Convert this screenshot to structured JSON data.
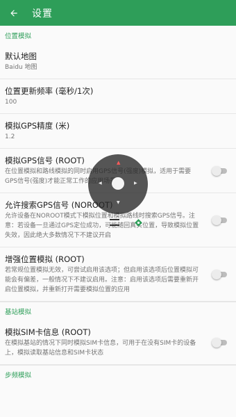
{
  "appbar": {
    "title": "设置",
    "back_icon": "arrow-back-icon"
  },
  "sections": {
    "location": "位置模拟",
    "base_station": "基站模拟",
    "step": "步频模拟"
  },
  "prefs": {
    "default_map": {
      "title": "默认地图",
      "summary": "Baidu 地图"
    },
    "update_freq": {
      "title": "位置更新频率 (毫秒/1次)",
      "summary": "100"
    },
    "gps_accuracy": {
      "title": "模拟GPS精度 (米)",
      "summary": "1.2"
    },
    "gps_signal": {
      "title": "模拟GPS信号 (ROOT)",
      "summary": "在位置模拟和路线模拟的同时启用GPS信号(强度)模拟，适用于需要GPS信号(强度)才能正常工作的应用场景",
      "enabled": false
    },
    "allow_search": {
      "title": "允许搜索GPS信号 (NOROOT)",
      "summary": "允许设备在NOROOT模式下模拟位置和模拟路线时搜索GPS信号。注意：若设备一旦通过GPS定位成功，可能随回真实位置，导致模拟位置失效，因此绝大多数情况下不建议开启",
      "enabled": false
    },
    "enhanced": {
      "title": "增强位置模拟 (ROOT)",
      "summary": "若常规位置模拟无效，可尝试启用该选项；但启用该选项后位置模拟可能会有偏差，一般情况下不建议启用。注意：启用该选项后需要重新开启位置模拟，并重新打开需要模拟位置的应用",
      "enabled": false
    },
    "sim_info": {
      "title": "模拟SIM卡信息 (ROOT)",
      "summary": "在模拟基站的情况下同时模拟SIM卡信息，可用于在没有SIM卡的设备上，模拟读取基站信息和SIM卡状态",
      "enabled": false
    }
  },
  "floating": {
    "joystick_up_label": "▲",
    "joystick_down_label": "▼",
    "joystick_left_label": "◀",
    "joystick_right_label": "▶",
    "icons": [
      "joystick-icon",
      "menu-icon",
      "navigation-icon"
    ]
  },
  "colors": {
    "accent": "#2e9e59",
    "switch_off": "#bdbdbd",
    "joystick_up": "#ff5a5a"
  }
}
